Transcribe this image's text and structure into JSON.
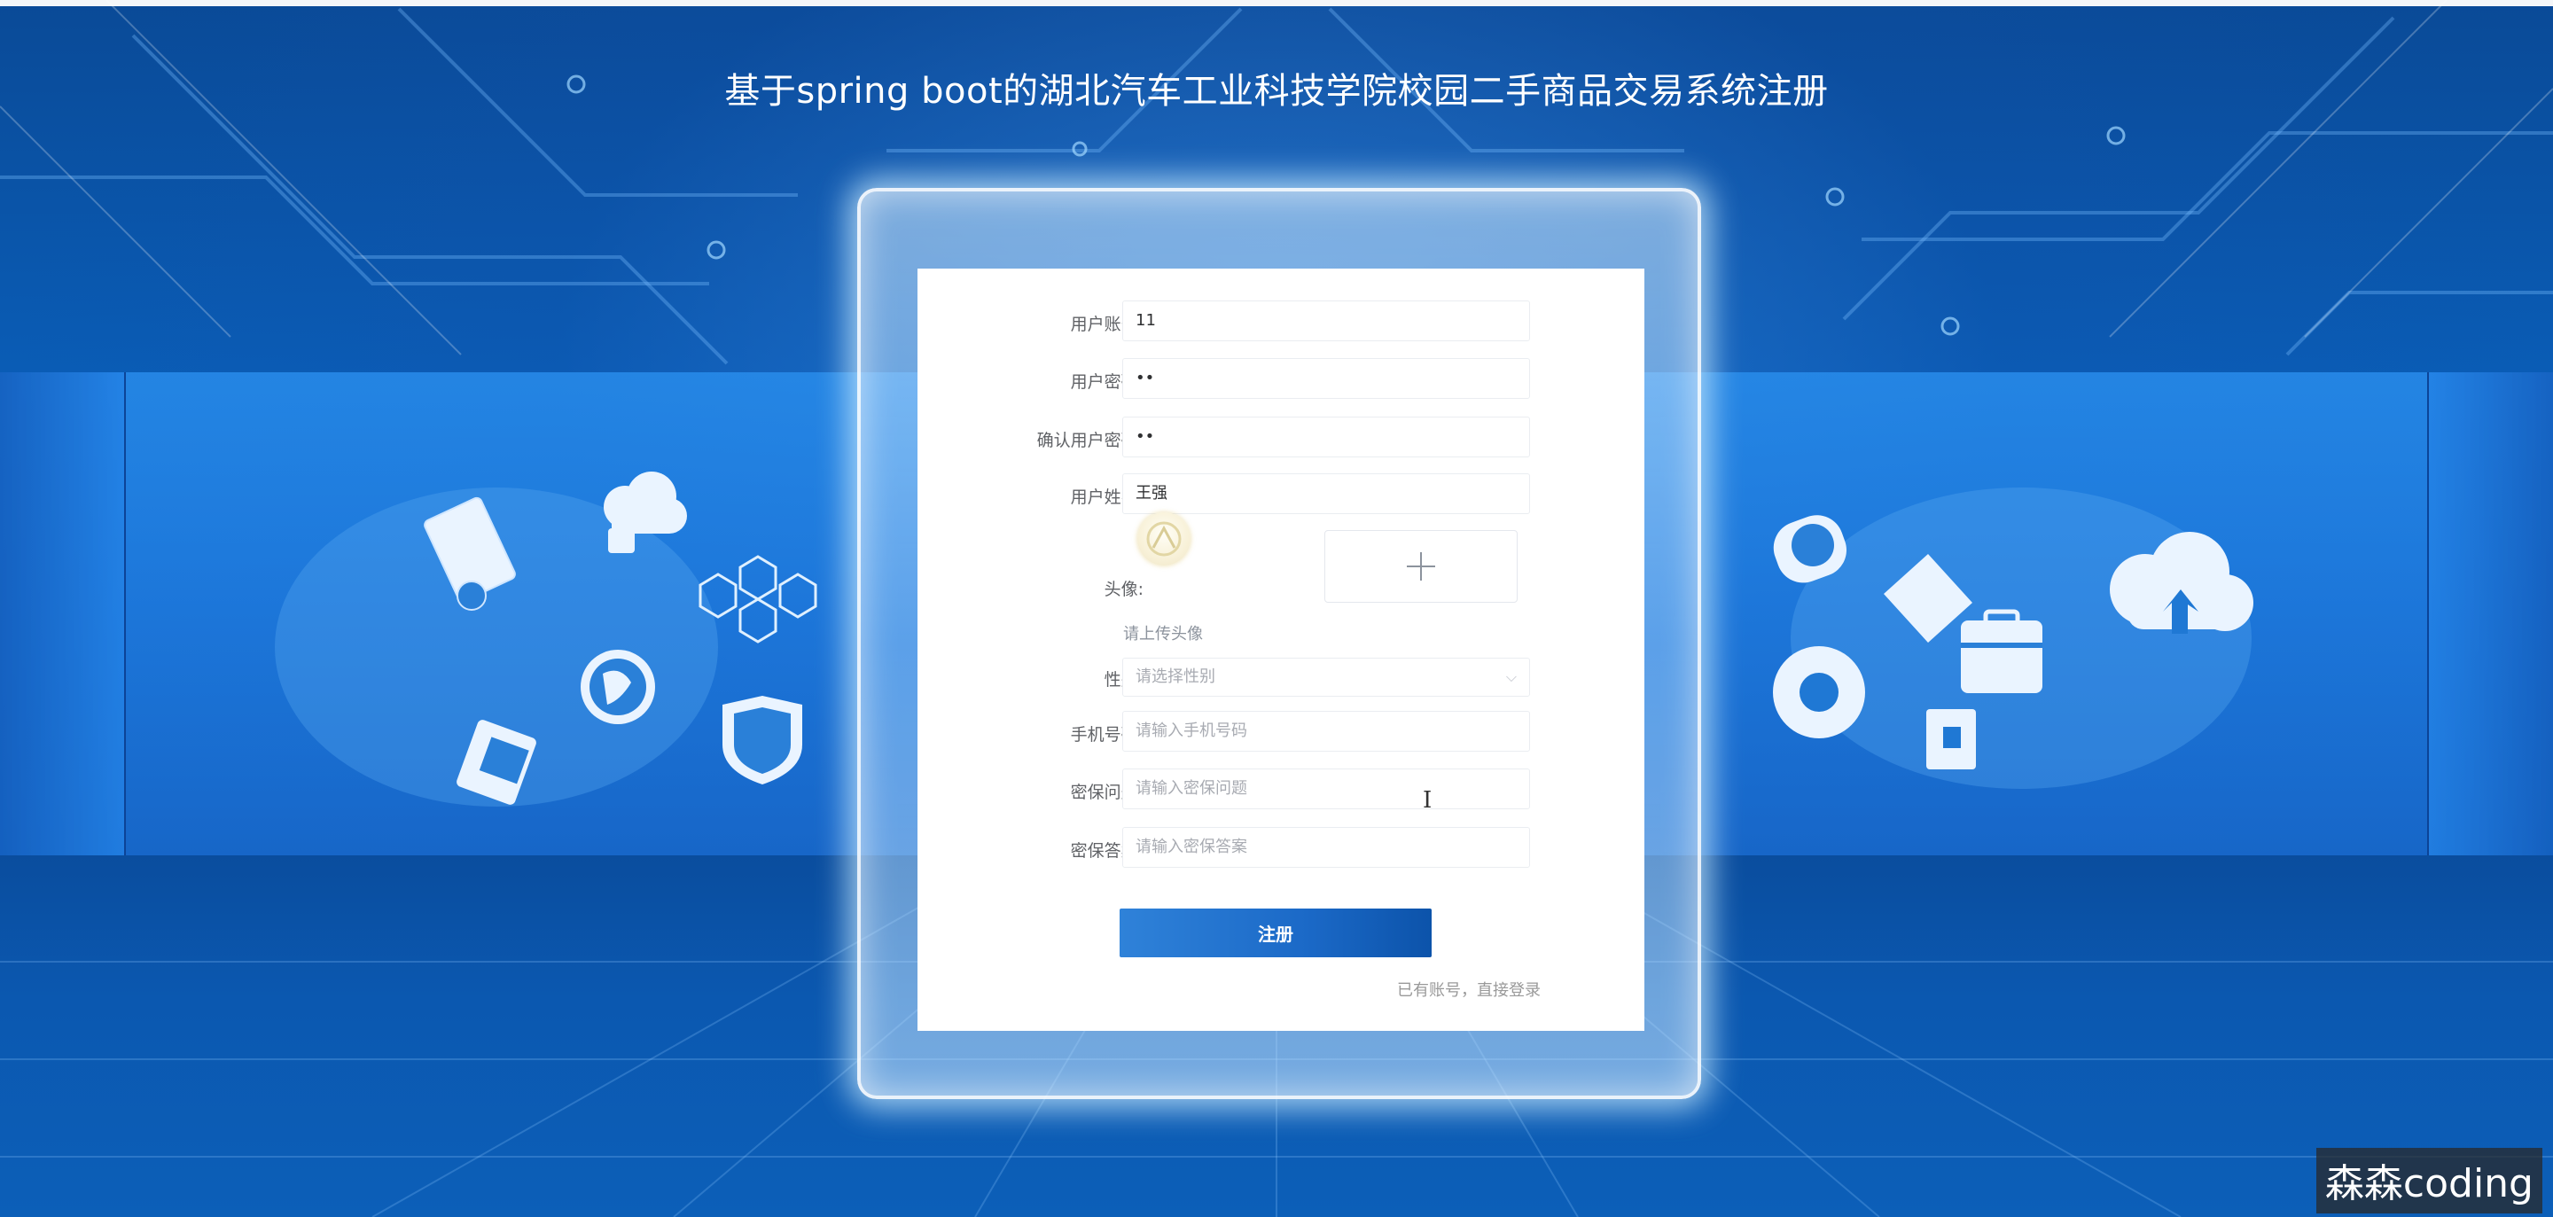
{
  "page": {
    "title": "基于spring boot的湖北汽车工业科技学院校园二手商品交易系统注册"
  },
  "form": {
    "username": {
      "label": "用户账号:",
      "value": "11"
    },
    "password": {
      "label": "用户密码:",
      "value": "••"
    },
    "confirm_password": {
      "label": "确认用户密码:",
      "value": "••"
    },
    "real_name": {
      "label": "用户姓名:",
      "value": "王强"
    },
    "avatar": {
      "label": "头像:",
      "hint": "请上传头像"
    },
    "gender": {
      "label": "性别:",
      "placeholder": "请选择性别"
    },
    "phone": {
      "label": "手机号码:",
      "placeholder": "请输入手机号码"
    },
    "security_question": {
      "label": "密保问题:",
      "placeholder": "请输入密保问题"
    },
    "security_answer": {
      "label": "密保答案:",
      "placeholder": "请输入密保答案"
    },
    "submit_label": "注册",
    "login_link": "已有账号，直接登录"
  },
  "watermark": {
    "text": "森森coding"
  },
  "colors": {
    "primary_button": "#1b69c7",
    "background": "#0b5cb5",
    "card": "#ffffff"
  }
}
